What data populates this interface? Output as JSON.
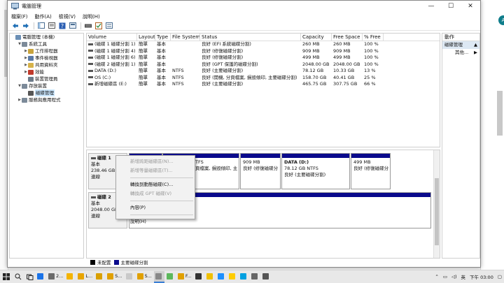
{
  "window": {
    "title": "電腦管理",
    "controls": [
      "—",
      "☐",
      "✕"
    ]
  },
  "menu": [
    "檔案(F)",
    "動作(A)",
    "檢視(V)",
    "說明(H)"
  ],
  "tree": {
    "items": [
      {
        "label": "電腦管理 (本機)",
        "level": 0,
        "arrow": "",
        "icon": "computer-icon",
        "color": "#6b8fb5"
      },
      {
        "label": "系統工具",
        "level": 1,
        "arrow": "▼",
        "icon": "tools-icon",
        "color": "#7c8a99"
      },
      {
        "label": "工作排程器",
        "level": 2,
        "arrow": "▶",
        "icon": "clock-icon",
        "color": "#c8a33c"
      },
      {
        "label": "事件檢視器",
        "level": 2,
        "arrow": "▶",
        "icon": "event-icon",
        "color": "#5a7aa6"
      },
      {
        "label": "共用資料夾",
        "level": 2,
        "arrow": "▶",
        "icon": "folder-icon",
        "color": "#d6b24a"
      },
      {
        "label": "效能",
        "level": 2,
        "arrow": "▶",
        "icon": "performance-icon",
        "color": "#c0392b"
      },
      {
        "label": "裝置管理員",
        "level": 2,
        "arrow": "",
        "icon": "device-icon",
        "color": "#6c7a89"
      },
      {
        "label": "存放裝置",
        "level": 1,
        "arrow": "▼",
        "icon": "storage-icon",
        "color": "#7c8a99"
      },
      {
        "label": "磁碟管理",
        "level": 2,
        "arrow": "",
        "icon": "disk-icon",
        "color": "#555555",
        "selected": true
      },
      {
        "label": "服務與應用程式",
        "level": 1,
        "arrow": "▶",
        "icon": "services-icon",
        "color": "#7c8a99"
      }
    ]
  },
  "volumes": {
    "headers": [
      "Volume",
      "Layout",
      "Type",
      "File System",
      "Status",
      "Capacity",
      "Free Space",
      "% Free"
    ],
    "rows": [
      {
        "volume": "(磁碟 1 磁碟分割 1)",
        "layout": "簡單",
        "type": "基本",
        "fs": "",
        "status": "良好 (EFI 系統磁碟分割)",
        "capacity": "260 MB",
        "free": "260 MB",
        "pct": "100 %"
      },
      {
        "volume": "(磁碟 1 磁碟分割 4)",
        "layout": "簡單",
        "type": "基本",
        "fs": "",
        "status": "良好 (修復磁碟分割)",
        "capacity": "909 MB",
        "free": "909 MB",
        "pct": "100 %"
      },
      {
        "volume": "(磁碟 1 磁碟分割 6)",
        "layout": "簡單",
        "type": "基本",
        "fs": "",
        "status": "良好 (修復磁碟分割)",
        "capacity": "499 MB",
        "free": "499 MB",
        "pct": "100 %"
      },
      {
        "volume": "(磁碟 2 磁碟分割 1)",
        "layout": "簡單",
        "type": "基本",
        "fs": "",
        "status": "良好 (GPT 保護的磁碟分割)",
        "capacity": "2048.00 GB",
        "free": "2048.00 GB",
        "pct": "100 %"
      },
      {
        "volume": "DATA (D:)",
        "layout": "簡單",
        "type": "基本",
        "fs": "NTFS",
        "status": "良好 (主要磁碟分割)",
        "capacity": "78.12 GB",
        "free": "10.33 GB",
        "pct": "13 %"
      },
      {
        "volume": "OS (C:)",
        "layout": "簡單",
        "type": "基本",
        "fs": "NTFS",
        "status": "良好 (開機, 分頁檔案, 損毀傾印, 主要磁碟分割)",
        "capacity": "158.70 GB",
        "free": "40.41 GB",
        "pct": "25 %"
      },
      {
        "volume": "新增磁碟區 (E:)",
        "layout": "簡單",
        "type": "基本",
        "fs": "NTFS",
        "status": "良好 (主要磁碟分割)",
        "capacity": "465.75 GB",
        "free": "307.75 GB",
        "pct": "66 %"
      }
    ]
  },
  "disks": [
    {
      "name": "磁碟 1",
      "type": "基本",
      "size": "238.46 GB",
      "state": "連線",
      "partitions": [
        {
          "line1": "",
          "line2": "",
          "line3": ""
        },
        {
          "line1": "",
          "line2": "TFS",
          "line3": "頁檔案, 損毀傾印, 主"
        },
        {
          "line1": "",
          "line2": "909 MB",
          "line3": "良好 (修復磁碟分"
        },
        {
          "line1": "DATA  (D:)",
          "line2": "78.12 GB NTFS",
          "line3": "良好 (主要磁碟分割)"
        },
        {
          "line1": "",
          "line2": "499 MB",
          "line3": "良好 (修復磁碟分"
        }
      ]
    },
    {
      "name": "磁碟 2",
      "type": "基本",
      "size": "2048.00 GB",
      "state": "連線",
      "partitions": [
        {
          "line1": "",
          "line2": "",
          "line3": ""
        }
      ]
    }
  ],
  "legend": [
    {
      "label": "未配置",
      "color": "#000000"
    },
    {
      "label": "主要磁碟分割",
      "color": "#0a0a8c"
    }
  ],
  "actions": {
    "header": "動作",
    "section": "磁碟管理",
    "section_arrow": "▲",
    "more": "其他...",
    "more_arrow": "▶"
  },
  "context_menu": {
    "items": [
      {
        "label": "新增跨距磁碟區(N)...",
        "disabled": true
      },
      {
        "label": "新增等量磁碟區(T)...",
        "disabled": true
      },
      {
        "sep": true
      },
      {
        "label": "轉換到動態磁碟(C)...",
        "disabled": false
      },
      {
        "label": "轉換成 GPT 磁碟(V)",
        "disabled": true
      },
      {
        "sep": true
      },
      {
        "label": "內容(P)",
        "disabled": false
      },
      {
        "sep": true
      },
      {
        "label": "說明(H)",
        "disabled": false
      }
    ]
  },
  "taskbar": {
    "apps": [
      {
        "label": "",
        "color": "#1a73e8"
      },
      {
        "label": "2...",
        "color": "#6a6a6a"
      },
      {
        "label": "",
        "color": "#f4b400"
      },
      {
        "label": "L...",
        "color": "#e8a400"
      },
      {
        "label": "",
        "color": "#d9a000"
      },
      {
        "label": "S...",
        "color": "#e0a000"
      },
      {
        "label": "",
        "color": "#c9c9c9"
      },
      {
        "label": "S...",
        "color": "#e0a000"
      },
      {
        "label": "",
        "color": "#888888"
      },
      {
        "label": "",
        "color": "#5cb85c"
      },
      {
        "label": "F...",
        "color": "#e0a000"
      },
      {
        "label": "",
        "color": "#333333"
      },
      {
        "label": "",
        "color": "#f0c000"
      },
      {
        "label": "",
        "color": "#1e90ff"
      },
      {
        "label": "",
        "color": "#ffcc00"
      },
      {
        "label": "",
        "color": "#00a0e0"
      },
      {
        "label": "",
        "color": "#666666"
      },
      {
        "label": "",
        "color": "#555555"
      }
    ],
    "language": "英",
    "time": "下午 03:00"
  },
  "background": {
    "avatar_letter": "A"
  }
}
